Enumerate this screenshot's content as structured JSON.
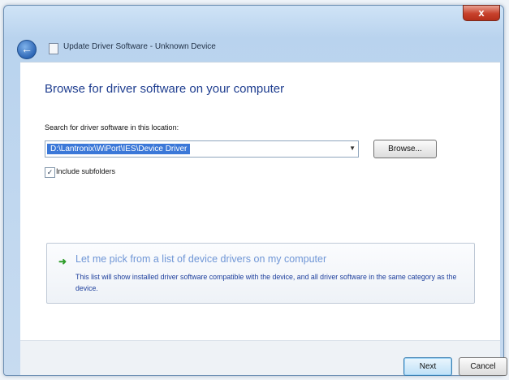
{
  "window": {
    "title": "Update Driver Software - Unknown Device",
    "close_label": "x"
  },
  "main": {
    "heading": "Browse for driver software on your computer",
    "search_label": "Search for driver software in this location:",
    "path_value": "D:\\Lantronix\\WiPort\\IES\\Device Driver",
    "browse_label": "Browse...",
    "include_subfolders_label": "Include subfolders",
    "include_subfolders_checked": true
  },
  "link_card": {
    "title": "Let me pick from a list of device drivers on my computer",
    "description": "This list will show installed driver software compatible with the device, and all driver software in the same category as the device."
  },
  "footer": {
    "next_label": "Next",
    "cancel_label": "Cancel"
  },
  "icons": {
    "back": "back-arrow-icon",
    "wizard": "wizard-icon",
    "pick": "green-arrow-icon",
    "dropdown": "dropdown-arrow-icon",
    "checkbox": "checkmark-icon"
  },
  "colors": {
    "heading": "#1e3d8f",
    "link": "#6f96d6",
    "selection": "#3b78d8"
  }
}
